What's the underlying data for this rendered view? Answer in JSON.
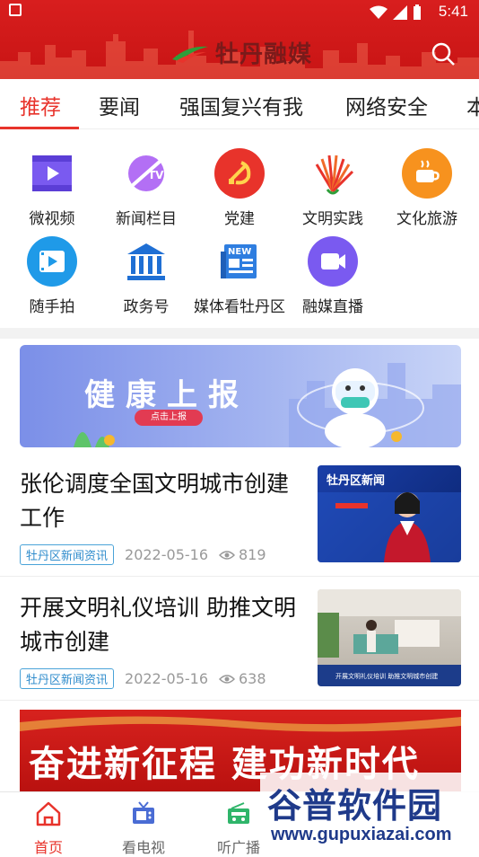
{
  "status_bar": {
    "time": "5:41"
  },
  "header": {
    "logo_text": "牡丹融媒"
  },
  "tabs": [
    {
      "label": "推荐",
      "active": true
    },
    {
      "label": "要闻"
    },
    {
      "label": "强国复兴有我"
    },
    {
      "label": "网络安全"
    },
    {
      "label": "本"
    }
  ],
  "grid": [
    {
      "label": "微视频",
      "icon": "video-icon"
    },
    {
      "label": "新闻栏目",
      "icon": "tv-icon"
    },
    {
      "label": "党建",
      "icon": "party-icon"
    },
    {
      "label": "文明实践",
      "icon": "fan-icon"
    },
    {
      "label": "文化旅游",
      "icon": "coffee-icon"
    },
    {
      "label": "随手拍",
      "icon": "film-icon"
    },
    {
      "label": "政务号",
      "icon": "government-icon"
    },
    {
      "label": "媒体看牡丹区",
      "icon": "newspaper-icon"
    },
    {
      "label": "融媒直播",
      "icon": "camera-icon"
    }
  ],
  "banner": {
    "title": "健康上报",
    "button": "点击上报"
  },
  "news": [
    {
      "title": "张伦调度全国文明城市创建工作",
      "tag": "牡丹区新闻资讯",
      "date": "2022-05-16",
      "views": "819",
      "thumb_caption": "牡丹区新闻"
    },
    {
      "title": "开展文明礼仪培训 助推文明城市创建",
      "tag": "牡丹区新闻资讯",
      "date": "2022-05-16",
      "views": "638",
      "thumb_caption": "开展文明礼仪培训 助推文明城市创建"
    }
  ],
  "red_banner": {
    "text": "奋进新征程 建功新时代"
  },
  "bottom_nav": [
    {
      "label": "首页",
      "active": true
    },
    {
      "label": "看电视"
    },
    {
      "label": "听广播"
    }
  ],
  "watermark": {
    "text": "谷普软件园",
    "url": "www.gupuxiazai.com"
  },
  "colors": {
    "brand_red": "#e8332b",
    "header_red": "#d81e1e",
    "tag_blue": "#2f8ccc"
  }
}
